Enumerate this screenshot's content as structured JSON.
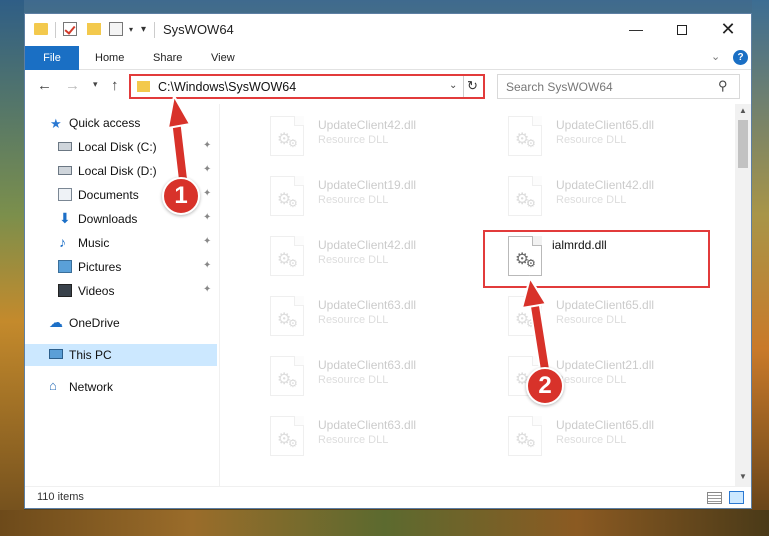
{
  "window": {
    "title": "SysWOW64",
    "minimize_label": "—",
    "close_label": "✕"
  },
  "ribbon": {
    "file": "File",
    "home": "Home",
    "share": "Share",
    "view": "View",
    "help": "?"
  },
  "navigation": {
    "address": "C:\\Windows\\SysWOW64",
    "search_placeholder": "Search SysWOW64"
  },
  "sidebar": {
    "items": [
      {
        "label": "Quick access",
        "icon": "star-icon"
      },
      {
        "label": "Local Disk (C:)",
        "icon": "drive-icon",
        "pinned": true
      },
      {
        "label": "Local Disk (D:)",
        "icon": "drive-icon",
        "pinned": true
      },
      {
        "label": "Documents",
        "icon": "documents-icon",
        "pinned": true
      },
      {
        "label": "Downloads",
        "icon": "download-icon",
        "pinned": true
      },
      {
        "label": "Music",
        "icon": "music-icon",
        "pinned": true
      },
      {
        "label": "Pictures",
        "icon": "pictures-icon",
        "pinned": true
      },
      {
        "label": "Videos",
        "icon": "videos-icon",
        "pinned": true
      },
      {
        "label": "OneDrive",
        "icon": "cloud-icon"
      },
      {
        "label": "This PC",
        "icon": "pc-icon",
        "selected": true
      },
      {
        "label": "Network",
        "icon": "network-icon"
      }
    ]
  },
  "files": {
    "col1": [
      {
        "name": "UpdateClient42.dll",
        "type": "Resource DLL"
      },
      {
        "name": "UpdateClient19.dll",
        "type": "Resource DLL"
      },
      {
        "name": "UpdateClient42.dll",
        "type": "Resource DLL"
      },
      {
        "name": "UpdateClient63.dll",
        "type": "Resource DLL"
      },
      {
        "name": "UpdateClient63.dll",
        "type": "Resource DLL"
      },
      {
        "name": "UpdateClient63.dll",
        "type": "Resource DLL"
      }
    ],
    "col2": [
      {
        "name": "UpdateClient65.dll",
        "type": "Resource DLL"
      },
      {
        "name": "UpdateClient42.dll",
        "type": "Resource DLL"
      },
      {
        "name": "ialmrdd.dll",
        "type": ""
      },
      {
        "name": "UpdateClient65.dll",
        "type": "Resource DLL"
      },
      {
        "name": "UpdateClient21.dll",
        "type": "Resource DLL"
      },
      {
        "name": "UpdateClient65.dll",
        "type": "Resource DLL"
      }
    ]
  },
  "status": {
    "item_count": "110 items"
  },
  "annotations": {
    "step1": "1",
    "step2": "2",
    "highlight_color": "#e23b3b"
  }
}
